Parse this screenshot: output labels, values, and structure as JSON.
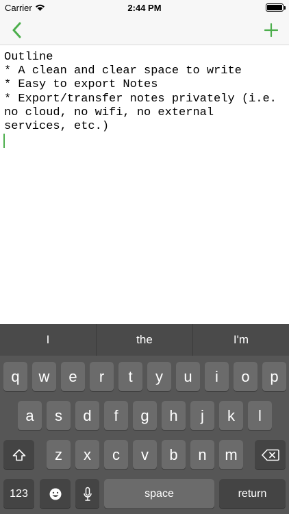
{
  "status_bar": {
    "carrier": "Carrier",
    "time": "2:44 PM",
    "battery_level": 1.0
  },
  "nav": {
    "back_icon": "chevron-left-icon",
    "add_icon": "plus-icon",
    "accent_color": "#4cae4c"
  },
  "note": {
    "lines": [
      "Outline",
      "* A clean and clear space to write",
      "* Easy to export Notes",
      "* Export/transfer notes privately (i.e.",
      "no cloud, no wifi, no external",
      "services, etc.)"
    ]
  },
  "keyboard": {
    "suggestions": [
      "I",
      "the",
      "I'm"
    ],
    "row1": [
      "q",
      "w",
      "e",
      "r",
      "t",
      "y",
      "u",
      "i",
      "o",
      "p"
    ],
    "row2": [
      "a",
      "s",
      "d",
      "f",
      "g",
      "h",
      "j",
      "k",
      "l"
    ],
    "row3": [
      "z",
      "x",
      "c",
      "v",
      "b",
      "n",
      "m"
    ],
    "shift_icon": "shift-icon",
    "delete_icon": "delete-icon",
    "numbers_label": "123",
    "emoji_icon": "emoji-icon",
    "mic_icon": "microphone-icon",
    "space_label": "space",
    "return_label": "return"
  }
}
